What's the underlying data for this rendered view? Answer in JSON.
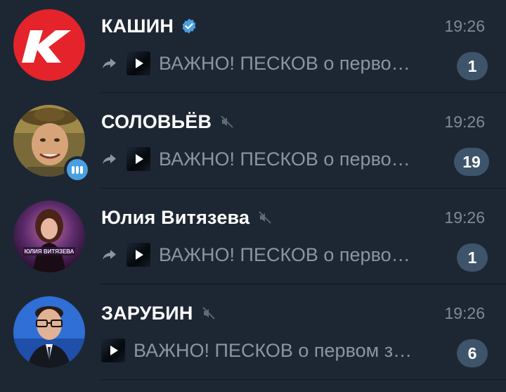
{
  "chats": [
    {
      "name": "КАШИН",
      "verified": true,
      "muted": false,
      "time": "19:26",
      "forwarded": true,
      "preview": "ВАЖНО!  ПЕСКОВ о перво…",
      "unread": "1",
      "avatar_icon": "red-k-logo",
      "avatar_color": "#e5232a"
    },
    {
      "name": "СОЛОВЬЁВ",
      "verified": false,
      "muted": true,
      "time": "19:26",
      "forwarded": true,
      "preview": "ВАЖНО!  ПЕСКОВ о перво…",
      "unread": "19",
      "avatar_icon": "man-in-hat-photo",
      "voice_chat": true
    },
    {
      "name": "Юлия Витязева",
      "verified": false,
      "muted": true,
      "time": "19:26",
      "forwarded": true,
      "preview": "ВАЖНО!  ПЕСКОВ о перво…",
      "unread": "1",
      "avatar_icon": "woman-photo",
      "avatar_caption": "ЮЛИЯ ВИТЯЗЕВА"
    },
    {
      "name": "ЗАРУБИН",
      "verified": false,
      "muted": true,
      "time": "19:26",
      "forwarded": false,
      "preview": "ВАЖНО!  ПЕСКОВ о первом з…",
      "unread": "6",
      "avatar_icon": "man-with-glasses-photo",
      "avatar_color": "#2f6fd6"
    }
  ],
  "colors": {
    "background": "#1d2733",
    "name": "#ffffff",
    "preview": "#8a96a3",
    "time": "#7e8a97",
    "badge": "#3e546a",
    "verified": "#4a9fe0"
  }
}
